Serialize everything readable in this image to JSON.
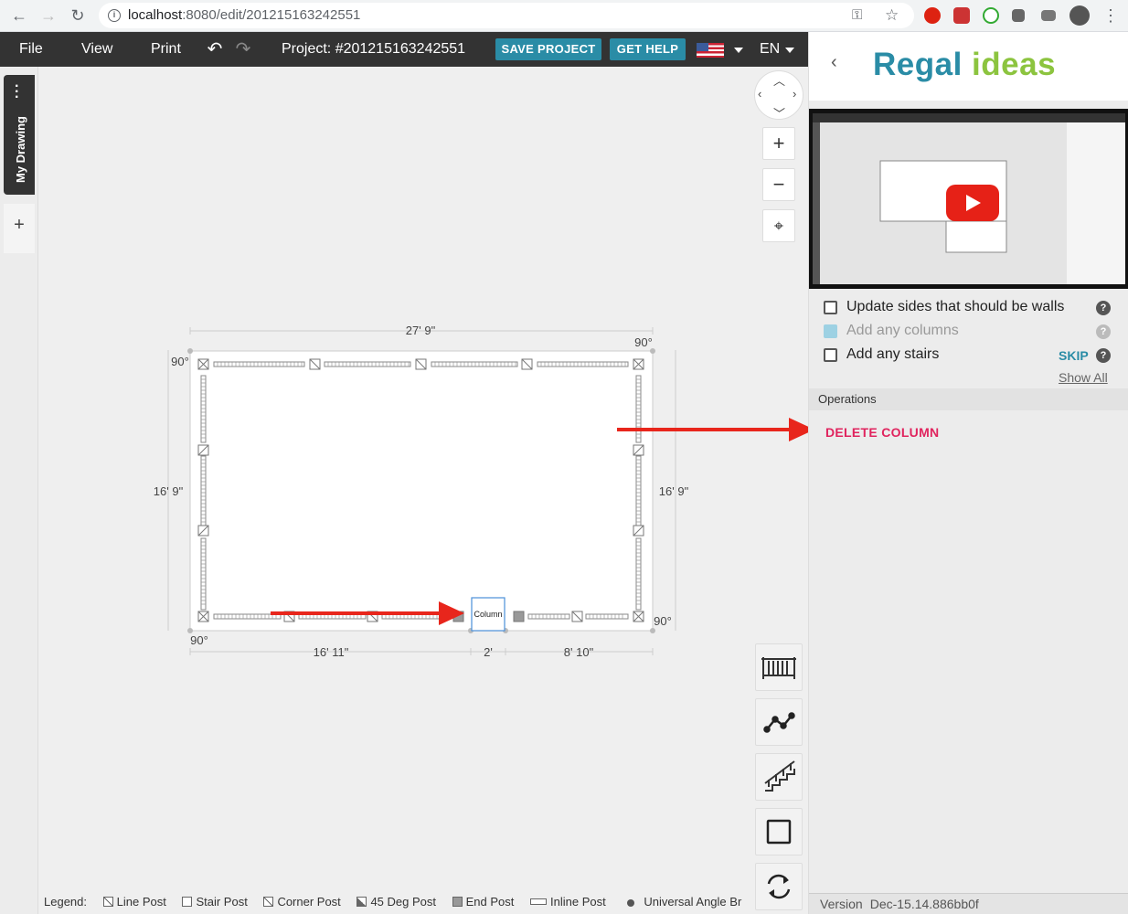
{
  "browser": {
    "url_host": "localhost",
    "url_path": ":8080/edit/201215163242551"
  },
  "toolbar": {
    "menu": [
      "File",
      "View",
      "Print"
    ],
    "project": "Project: #201215163242551",
    "save_label": "SAVE PROJECT",
    "help_label": "GET HELP",
    "lang": "EN"
  },
  "left_tabs": {
    "drawing": "My Drawing",
    "add": "+"
  },
  "drawing": {
    "dims": {
      "top": "27' 9\"",
      "left": "16' 9\"",
      "right": "16' 9\"",
      "bottom_a": "16' 11\"",
      "bottom_b": "2'",
      "bottom_c": "8' 10\""
    },
    "angles": {
      "top_left": "90°",
      "top_right": "90°",
      "bottom_left": "90°",
      "bottom_right": "90°"
    },
    "column_label": "Column"
  },
  "canvas_controls": {
    "zoom_in": "+",
    "zoom_out": "−"
  },
  "legend": {
    "title": "Legend:",
    "items": [
      "Line Post",
      "Stair Post",
      "Corner Post",
      "45 Deg Post",
      "End Post",
      "Inline Post",
      "Universal Angle Br"
    ]
  },
  "panel": {
    "logo_a": "Regal",
    "logo_b": "ideas",
    "checklist": [
      {
        "label": "Update sides that should be walls",
        "checked": false
      },
      {
        "label": "Add any columns",
        "checked": true
      },
      {
        "label": "Add any stairs",
        "checked": false
      }
    ],
    "skip": "SKIP",
    "show_all": "Show All",
    "operations_title": "Operations",
    "delete_column": "DELETE COLUMN",
    "version_label": "Version",
    "version_value": "Dec-15.14.886bb0f"
  },
  "colors": {
    "accent": "#2a8ca6",
    "brand_green": "#8cc43f",
    "danger": "#e0245e",
    "arrow": "#e8261c",
    "toolbar_bg": "#333333"
  }
}
